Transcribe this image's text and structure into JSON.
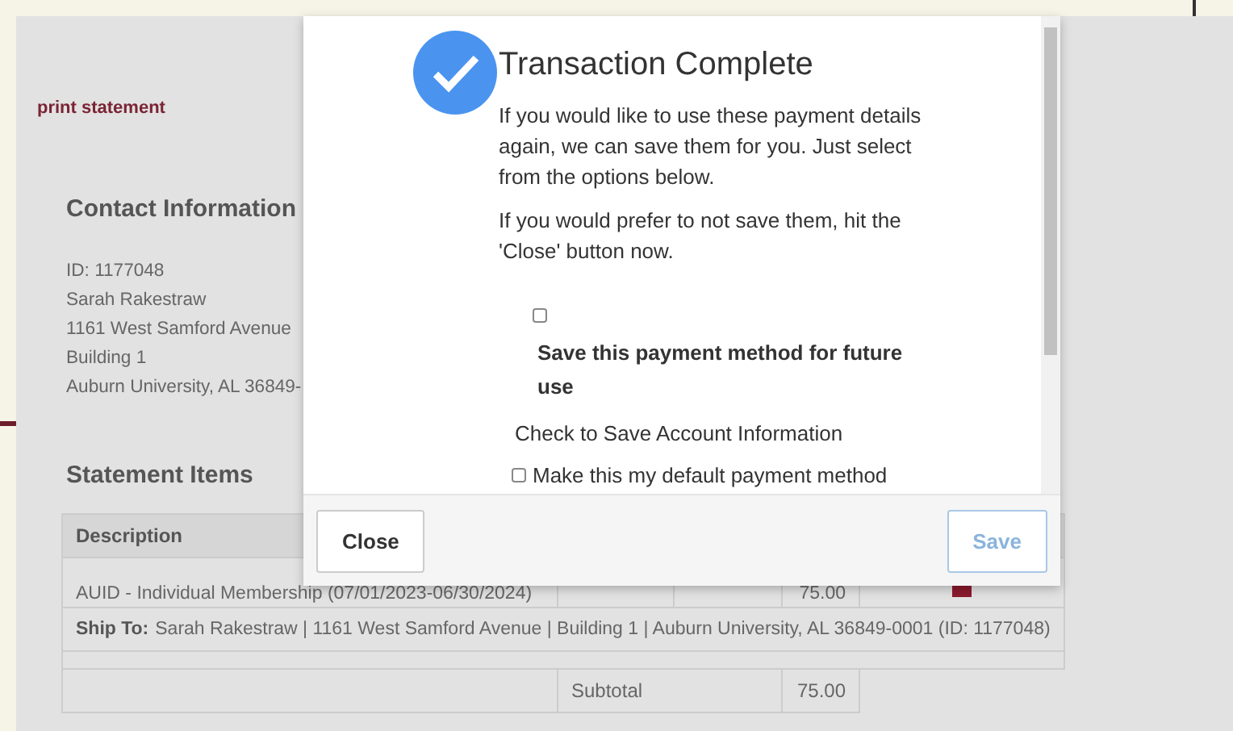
{
  "page": {
    "print_link": "print statement",
    "contact": {
      "heading": "Contact Information",
      "lines": [
        "ID: 1177048",
        "Sarah Rakestraw",
        "1161 West Samford Avenue",
        "Building 1",
        "Auburn University, AL 36849-"
      ]
    },
    "statement": {
      "heading": "Statement Items",
      "columns": [
        "Description"
      ],
      "rows": [
        {
          "description": "AUID - Individual Membership (07/01/2023-06/30/2024)",
          "amount": "75.00"
        }
      ],
      "ship_to": {
        "label": "Ship To:",
        "value": "Sarah Rakestraw | 1161 West Samford Avenue | Building 1 | Auburn University, AL 36849-0001 (ID: 1177048)"
      },
      "subtotal": {
        "label": "Subtotal",
        "value": "75.00"
      }
    }
  },
  "modal": {
    "title": "Transaction Complete",
    "paragraphs": [
      "If you would like to use these payment details again, we can save them for you. Just select from the options below.",
      "If you would prefer to not save them, hit the 'Close' button now."
    ],
    "save_option": {
      "label": "Save this payment method for future use",
      "checked": false
    },
    "hint": "Check to Save Account Information",
    "default_option": {
      "label": "Make this my default payment method",
      "checked": false
    },
    "buttons": [
      {
        "label": "Close",
        "disabled": false
      },
      {
        "label": "Save",
        "disabled": true
      }
    ]
  }
}
